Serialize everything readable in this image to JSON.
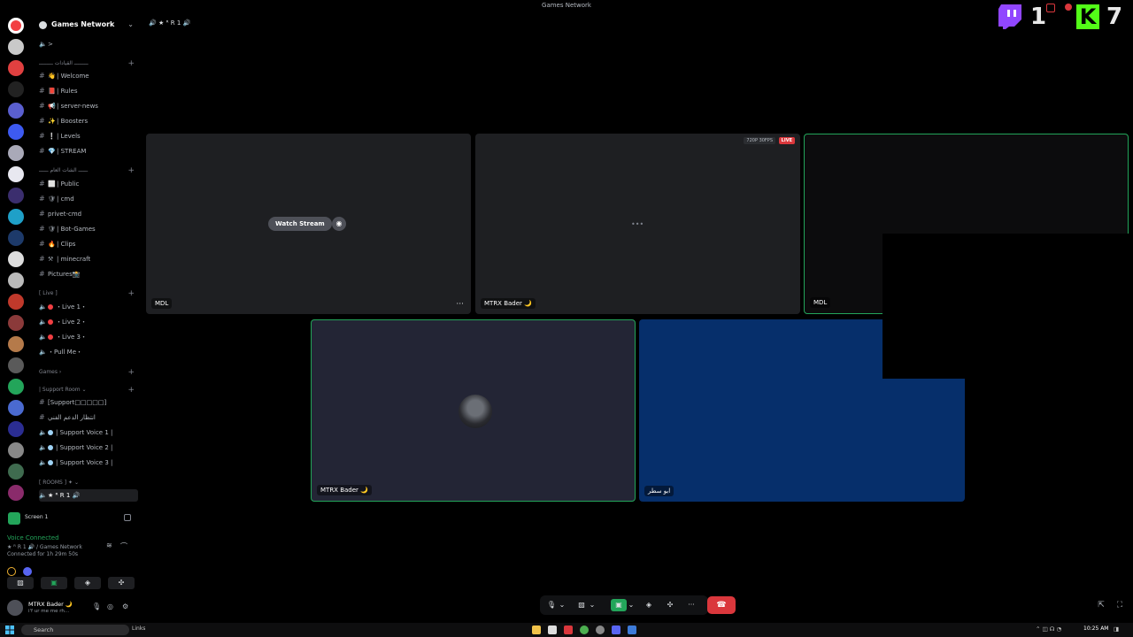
{
  "window": {
    "title": "Games Network"
  },
  "overlay": {
    "count_left": "1",
    "count_right": "7",
    "kick_letter": "K"
  },
  "guild": {
    "name": "Games Network",
    "chevron": "⌄"
  },
  "channels": [
    {
      "type": "text-voice",
      "emoji": "🔈",
      "name": ">"
    },
    {
      "type": "category",
      "name": "ـــــــــ القيادات ـــــــــ",
      "plus": "+"
    },
    {
      "type": "text",
      "emoji": "👋",
      "name": "| Welcome"
    },
    {
      "type": "text",
      "emoji": "📕",
      "name": "| Rules"
    },
    {
      "type": "text",
      "emoji": "📢",
      "name": "| server-news"
    },
    {
      "type": "text",
      "emoji": "✨",
      "name": "| Boosters"
    },
    {
      "type": "text",
      "emoji": "❕",
      "name": "| Levels"
    },
    {
      "type": "text",
      "emoji": "💎",
      "name": "| STREAM"
    },
    {
      "type": "category",
      "name": "ــــــ الشات العام ــــــ",
      "plus": "+"
    },
    {
      "type": "text",
      "emoji": "⬜",
      "name": "| Public"
    },
    {
      "type": "text",
      "emoji": "🛡",
      "name": "| cmd"
    },
    {
      "type": "text",
      "emoji": "",
      "name": "privet-cmd"
    },
    {
      "type": "text",
      "emoji": "🛡",
      "name": "| Bot-Games"
    },
    {
      "type": "text",
      "emoji": "🔥",
      "name": "| Clips"
    },
    {
      "type": "text",
      "emoji": "⚒",
      "name": "| minecraft"
    },
    {
      "type": "text",
      "emoji": "",
      "name": "Pictures📸"
    },
    {
      "type": "category",
      "name": "[ Live ]",
      "plus": "+"
    },
    {
      "type": "voice-red",
      "name": "・Live 1・"
    },
    {
      "type": "voice-red",
      "name": "・Live 2・"
    },
    {
      "type": "voice-red",
      "name": "・Live 3・"
    },
    {
      "type": "voice",
      "name": "・Pull Me・"
    },
    {
      "type": "category",
      "name": "Games ›",
      "plus": "+"
    },
    {
      "type": "category",
      "name": "| Support Room ⌄",
      "plus": "+"
    },
    {
      "type": "text",
      "emoji": "",
      "name": "[Support□□□□□]"
    },
    {
      "type": "text",
      "emoji": "",
      "name": "انتظار الدعم الفني"
    },
    {
      "type": "voice-blue",
      "name": "| Support Voice 1 |"
    },
    {
      "type": "voice-blue",
      "name": "| Support Voice 2 |"
    },
    {
      "type": "voice-blue",
      "name": "| Support Voice 3 |"
    },
    {
      "type": "category",
      "name": "[ ROOMS ] ✦ ⌄",
      "plus": ""
    },
    {
      "type": "voice-active",
      "name": "★ ᴿ R 1 🔊"
    }
  ],
  "screen_share": {
    "label": "Screen 1"
  },
  "voice_status": {
    "status": "Voice Connected",
    "channel": "★ ᴿ R 1 🔊 / Games Network",
    "time": "Connected for 1h 29m 50s"
  },
  "user": {
    "name": "MTRX Bader 🌙",
    "status": "i'f ur me me rh..."
  },
  "vc_header": "🔊 ★ ᴿ R 1 🔊",
  "tiles": [
    {
      "name": "MDL",
      "watch_label": "Watch Stream"
    },
    {
      "name": "MTRX Bader 🌙",
      "quality": "720P 30FPS",
      "live": "LIVE",
      "loading": "•••"
    },
    {
      "name": "MDL"
    },
    {
      "name": "MTRX Bader 🌙"
    },
    {
      "name": "ابو سطر"
    }
  ],
  "controls": {
    "hangup": "☎",
    "more": "···"
  },
  "taskbar": {
    "search_placeholder": "Search",
    "links": "Links",
    "time": "10:25 AM"
  },
  "colors": {
    "accent_green": "#23a55a",
    "danger": "#da373c",
    "tile_bg": "#1e1f22",
    "blue_tile": "#062f6b"
  }
}
